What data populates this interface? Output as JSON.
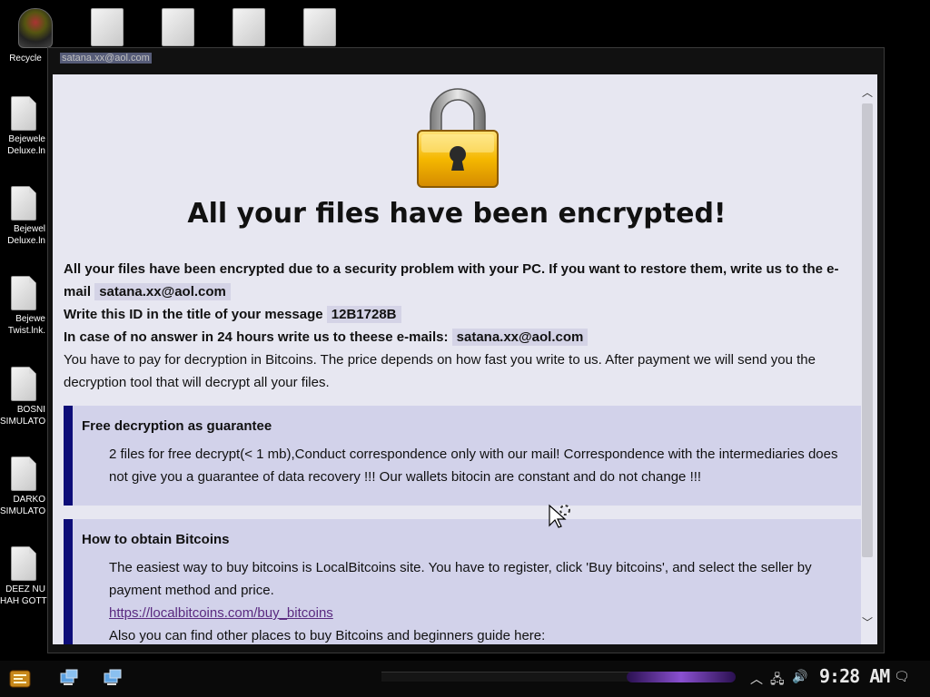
{
  "desktop": {
    "recycle_label": "Recycle",
    "left_icons": [
      {
        "line1": "Bejewele",
        "line2": "Deluxe.ln"
      },
      {
        "line1": "Bejewel",
        "line2": "Deluxe.ln"
      },
      {
        "line1": "Bejewe",
        "line2": "Twist.lnk."
      },
      {
        "line1": "BOSNI",
        "line2": "SIMULATO"
      },
      {
        "line1": "DARKO",
        "line2": "SIMULATO"
      },
      {
        "line1": "DEEZ NU",
        "line2": "HAH GOTT"
      }
    ]
  },
  "window": {
    "title": "satana.xx@aol.com"
  },
  "note": {
    "headline": "All your files have been encrypted!",
    "p1_prefix": "All your files have been encrypted due to a security problem with your PC. If you want to restore them, write us to the e-mail",
    "email": "satana.xx@aol.com",
    "p2_prefix": "Write this ID in the title of your message",
    "id": "12B1728B",
    "p3_prefix": "In case of no answer in 24 hours write us to theese e-mails:",
    "email2": "satana.xx@aol.com",
    "p4": "You have to pay for decryption in Bitcoins. The price depends on how fast you write to us. After payment we will send you the decryption tool that will decrypt all your files.",
    "box1_title": "Free decryption as guarantee",
    "box1_text": "2 files for free decrypt(< 1 mb),Conduct correspondence only with our mail! Correspondence with the intermediaries does not give you a guarantee of data recovery !!! Our wallets bitocin are constant and do not change !!!",
    "box2_title": "How to obtain Bitcoins",
    "box2_text": "The easiest way to buy bitcoins is LocalBitcoins site. You have to register, click 'Buy bitcoins', and select the seller by payment method and price.",
    "box2_link": "https://localbitcoins.com/buy_bitcoins",
    "box2_text2": "Also you can find other places to buy Bitcoins and beginners guide here:"
  },
  "taskbar": {
    "clock": "9:28 AM"
  },
  "colors": {
    "accent": "#0d0d78",
    "box_bg": "#d2d2ea",
    "page_bg": "#e7e7f1",
    "lock_gold": "#f2b400"
  }
}
